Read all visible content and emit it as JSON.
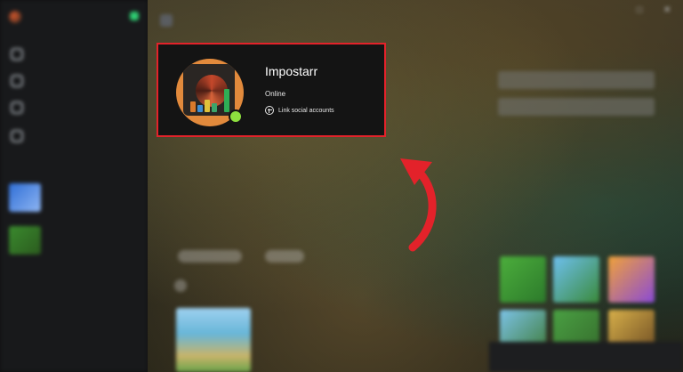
{
  "profile": {
    "gamertag": "Impostarr",
    "status": "Online",
    "link_social_label": "Link social accounts",
    "status_color": "#8ee03f"
  },
  "highlight": {
    "color": "#e3222a"
  },
  "arrow": {
    "color": "#e3222a"
  },
  "colors": {
    "sidebar_bg": "#18191b",
    "card_bg": "#141414",
    "accent_green": "#2ecc71"
  },
  "icons": [
    "plus-circle-icon",
    "curved-arrow-icon",
    "home-icon",
    "library-icon",
    "store-icon",
    "gear-icon"
  ]
}
